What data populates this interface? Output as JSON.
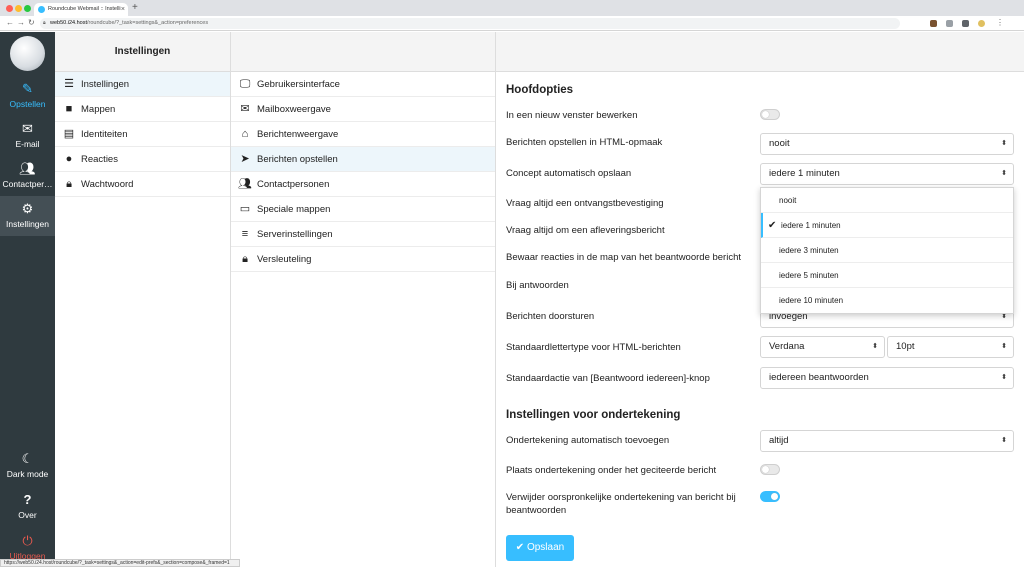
{
  "browser": {
    "tab_title": "Roundcube Webmail :: Instelli",
    "url_host": "web50.i24.host",
    "url_path": "/roundcube/?_task=settings&_action=preferences",
    "status_url": "https://web50.i24.host/roundcube/?_task=settings&_action=edit-prefs&_section=compose&_framed=1"
  },
  "nav": {
    "compose": "Opstellen",
    "email": "E-mail",
    "contacts": "Contactper…",
    "settings": "Instellingen",
    "darkmode": "Dark mode",
    "about": "Over",
    "logout": "Uitloggen"
  },
  "settings_list": {
    "header": "Instellingen",
    "items": [
      {
        "label": "Instellingen",
        "icon": "sliders-icon"
      },
      {
        "label": "Mappen",
        "icon": "folder-icon"
      },
      {
        "label": "Identiteiten",
        "icon": "id-card-icon"
      },
      {
        "label": "Reacties",
        "icon": "comment-icon"
      },
      {
        "label": "Wachtwoord",
        "icon": "lock-icon"
      }
    ]
  },
  "sections": {
    "items": [
      {
        "label": "Gebruikersinterface",
        "icon": "desktop-icon"
      },
      {
        "label": "Mailboxweergave",
        "icon": "envelope-icon"
      },
      {
        "label": "Berichtenweergave",
        "icon": "inbox-icon"
      },
      {
        "label": "Berichten opstellen",
        "icon": "paper-plane-icon"
      },
      {
        "label": "Contactpersonen",
        "icon": "users-icon"
      },
      {
        "label": "Speciale mappen",
        "icon": "folder-open-icon"
      },
      {
        "label": "Serverinstellingen",
        "icon": "server-icon"
      },
      {
        "label": "Versleuteling",
        "icon": "lock-icon"
      }
    ]
  },
  "main": {
    "section1_title": "Hoofdopties",
    "new_window": "In een nieuw venster bewerken",
    "html_compose": "Berichten opstellen in HTML-opmaak",
    "html_compose_value": "nooit",
    "draft_autosave": "Concept automatisch opslaan",
    "draft_autosave_value": "iedere 1 minuten",
    "receipt": "Vraag altijd een ontvangstbevestiging",
    "delivery": "Vraag altijd om een afleveringsbericht",
    "reply_folder": "Bewaar reacties in de map van het beantwoorde bericht",
    "reply_mode": "Bij antwoorden",
    "forward": "Berichten doorsturen",
    "forward_value": "invoegen",
    "default_font": "Standaardlettertype voor HTML-berichten",
    "font_value": "Verdana",
    "font_size_value": "10pt",
    "reply_all": "Standaardactie van [Beantwoord iedereen]-knop",
    "reply_all_value": "iedereen beantwoorden",
    "section2_title": "Instellingen voor ondertekening",
    "sig_auto": "Ondertekening automatisch toevoegen",
    "sig_auto_value": "altijd",
    "sig_below": "Plaats ondertekening onder het geciteerde bericht",
    "sig_strip": "Verwijder oorspronkelijke ondertekening van bericht bij beantwoorden",
    "save": "Opslaan",
    "toggles": {
      "new_window": false,
      "sig_below": false,
      "sig_strip": true
    }
  },
  "dropdown": {
    "options": [
      "nooit",
      "iedere 1 minuten",
      "iedere 3 minuten",
      "iedere 5 minuten",
      "iedere 10 minuten"
    ],
    "selected": "iedere 1 minuten"
  },
  "colors": {
    "accent": "#37beff",
    "sidebar": "#2f3a3f",
    "logout": "#e85a4f"
  }
}
